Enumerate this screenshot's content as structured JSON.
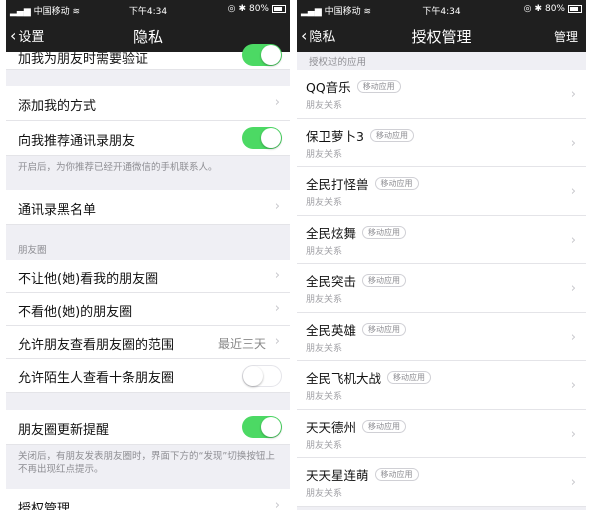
{
  "status_bar": {
    "carrier": "中国移动",
    "time": "下午4:34",
    "battery": "80%"
  },
  "left_screen": {
    "back_label": "设置",
    "title": "隐私",
    "partial_row": "加我为朋友时需要验证",
    "add_me_ways": "添加我的方式",
    "recommend_contacts": "向我推荐通讯录朋友",
    "recommend_note": "开启后，为你推荐已经开通微信的手机联系人。",
    "blacklist": "通讯录黑名单",
    "moments_header": "朋友圈",
    "hide_my_moments": "不让他(她)看我的朋友圈",
    "dont_see_moments": "不看他(她)的朋友圈",
    "moments_range_label": "允许朋友查看朋友圈的范围",
    "moments_range_value": "最近三天",
    "stranger_ten": "允许陌生人查看十条朋友圈",
    "moments_update": "朋友圈更新提醒",
    "update_note": "关闭后，有朋友发表朋友圈时，界面下方的“发现”切换按钮上不再出现红点提示。",
    "auth_manage": "授权管理",
    "toggles": {
      "partial": true,
      "recommend": true,
      "stranger": false,
      "update": true
    }
  },
  "right_screen": {
    "back_label": "隐私",
    "title": "授权管理",
    "right_action": "管理",
    "section_header": "授权过的应用",
    "badge_label": "移动应用",
    "subtitle": "朋友关系",
    "apps": [
      {
        "name": "QQ音乐"
      },
      {
        "name": "保卫萝卜3"
      },
      {
        "name": "全民打怪兽"
      },
      {
        "name": "全民炫舞"
      },
      {
        "name": "全民突击"
      },
      {
        "name": "全民英雄"
      },
      {
        "name": "全民飞机大战"
      },
      {
        "name": "天天德州"
      },
      {
        "name": "天天星连萌"
      }
    ]
  },
  "colors": {
    "toggle_on": "#4cd964",
    "nav_bg": "#1f1f1f",
    "page_bg": "#efeff4"
  }
}
